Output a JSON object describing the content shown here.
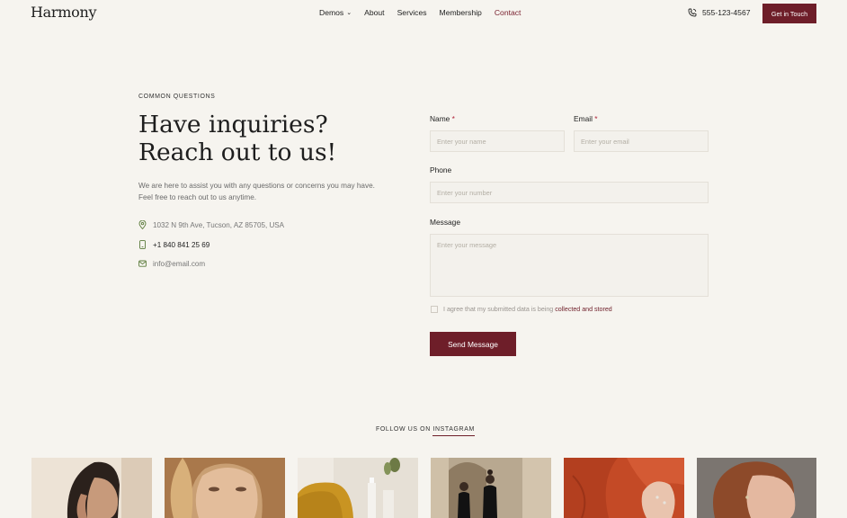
{
  "header": {
    "logo": "Harmony",
    "nav": [
      {
        "label": "Demos",
        "has_dropdown": true,
        "active": false
      },
      {
        "label": "About",
        "has_dropdown": false,
        "active": false
      },
      {
        "label": "Services",
        "has_dropdown": false,
        "active": false
      },
      {
        "label": "Membership",
        "has_dropdown": false,
        "active": false
      },
      {
        "label": "Contact",
        "has_dropdown": false,
        "active": true
      }
    ],
    "phone": "555-123-4567",
    "cta": "Get in Touch"
  },
  "intro": {
    "eyebrow": "COMMON QUESTIONS",
    "heading_line1": "Have inquiries?",
    "heading_line2": "Reach out to us!",
    "text": "We are here to assist you with any questions or concerns you may have. Feel free to reach out to us anytime.",
    "address": "1032 N 9th Ave, Tucson, AZ 85705, USA",
    "phone": "+1 840 841 25 69",
    "email": "info@email.com"
  },
  "form": {
    "name_label": "Name",
    "name_placeholder": "Enter your name",
    "email_label": "Email",
    "email_placeholder": "Enter your email",
    "required_mark": "*",
    "phone_label": "Phone",
    "phone_placeholder": "Enter your number",
    "message_label": "Message",
    "message_placeholder": "Enter your message",
    "agree_text": "I agree that my submitted data is being",
    "agree_link": "collected and stored",
    "submit": "Send Message"
  },
  "instagram": {
    "follow_prefix": "FOLLOW US ON",
    "follow_word": "INSTAGRAM",
    "images": [
      "portrait-woman-sleek-hair",
      "portrait-blonde-woman",
      "skincare-bottles-yellow-chair",
      "women-black-dresses-arches",
      "hands-rust-blouse-rings",
      "portrait-woman-auburn-hair"
    ]
  },
  "colors": {
    "accent": "#6e1e29",
    "background": "#f6f4ef"
  }
}
